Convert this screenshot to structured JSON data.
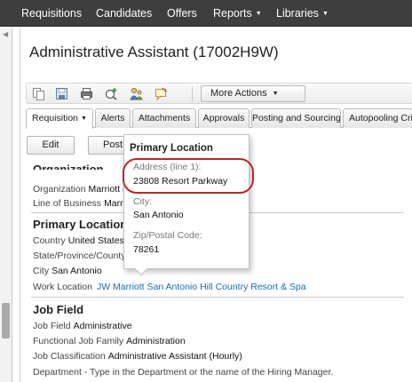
{
  "topnav": {
    "items": [
      {
        "label": "Requisitions",
        "dropdown": false
      },
      {
        "label": "Candidates",
        "dropdown": false
      },
      {
        "label": "Offers",
        "dropdown": false
      },
      {
        "label": "Reports",
        "dropdown": true
      },
      {
        "label": "Libraries",
        "dropdown": true
      }
    ]
  },
  "page": {
    "title": "Administrative Assistant (17002H9W)"
  },
  "toolbar": {
    "icons": [
      "copy-icon",
      "save-icon",
      "print-icon",
      "add-tag-icon",
      "people-icon",
      "comment-icon"
    ],
    "more_actions": "More Actions"
  },
  "tabs": [
    {
      "label": "Requisition",
      "active": true,
      "dropdown": true
    },
    {
      "label": "Alerts"
    },
    {
      "label": "Attachments"
    },
    {
      "label": "Approvals"
    },
    {
      "label": "Posting and Sourcing"
    },
    {
      "label": "Autopooling Criteria"
    }
  ],
  "buttons": {
    "edit": "Edit",
    "post": "Post"
  },
  "form": {
    "org_heading": "Organization",
    "organization_label": "Organization",
    "organization_value": "Marriott H",
    "line_of_business_label": "Line of Business",
    "line_of_business_value": "Marri",
    "primary_location_heading": "Primary Location",
    "country_label": "Country",
    "country_value": "United States",
    "state_label": "State/Province/County",
    "city_label": "City",
    "city_value": "San Antonio",
    "work_location_label": "Work Location",
    "work_location_value": "JW Marriott San Antonio Hill Country Resort & Spa",
    "job_field_heading": "Job Field",
    "job_field_label": "Job Field",
    "job_field_value": "Administrative",
    "functional_job_family_label": "Functional Job Family",
    "functional_job_family_value": "Administration",
    "job_classification_label": "Job Classification",
    "job_classification_value": "Administrative Assistant (Hourly)",
    "department_text": "Department - Type in the Department or the name of the Hiring Manager."
  },
  "popup": {
    "title": "Primary Location",
    "address_label": "Address (line 1):",
    "address_value": "23808 Resort Parkway",
    "city_label": "City:",
    "city_value": "San Antonio",
    "zip_label": "Zip/Postal Code:",
    "zip_value": "78261"
  },
  "colors": {
    "nav_bg": "#3e3e3e",
    "link": "#1a6bb3",
    "highlight_ring": "#b22a2a"
  }
}
